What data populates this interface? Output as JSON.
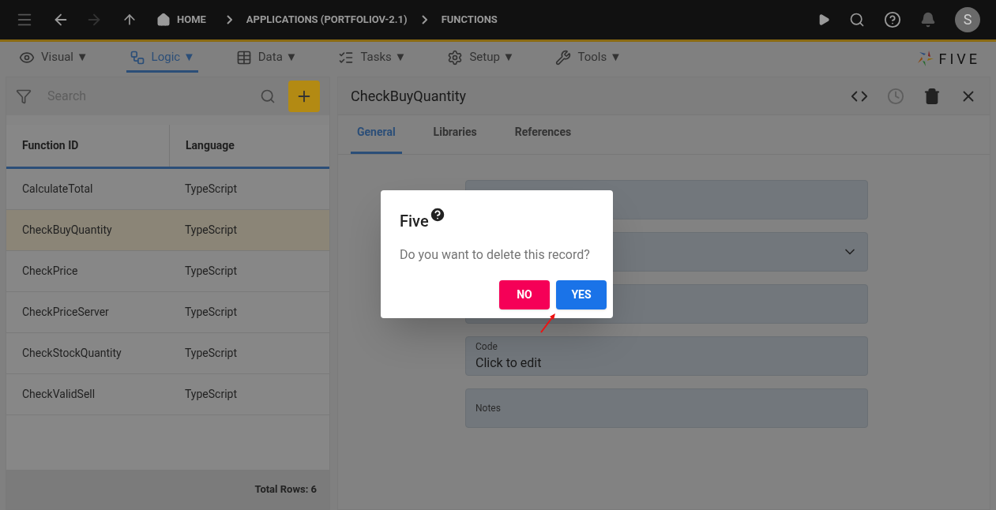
{
  "top_bar": {
    "breadcrumbs": [
      "HOME",
      "APPLICATIONS (PORTFOLIOV-2.1)",
      "FUNCTIONS"
    ],
    "avatar": "S"
  },
  "menu": [
    {
      "label": "Visual",
      "caret": "▼",
      "selected": false
    },
    {
      "label": "Logic",
      "caret": "▼",
      "selected": true
    },
    {
      "label": "Data",
      "caret": "▼",
      "selected": false
    },
    {
      "label": "Tasks",
      "caret": "▼",
      "selected": false
    },
    {
      "label": "Setup",
      "caret": "▼",
      "selected": false
    },
    {
      "label": "Tools",
      "caret": "▼",
      "selected": false
    }
  ],
  "logo": "FIVE",
  "list_panel": {
    "search": {
      "placeholder": "Search"
    },
    "columns": [
      "Function ID",
      "Language"
    ],
    "rows": [
      {
        "cells": [
          "CalculateTotal",
          "TypeScript"
        ],
        "selected": false
      },
      {
        "cells": [
          "CheckBuyQuantity",
          "TypeScript"
        ],
        "selected": true
      },
      {
        "cells": [
          "CheckPrice",
          "TypeScript"
        ],
        "selected": false
      },
      {
        "cells": [
          "CheckPriceServer",
          "TypeScript"
        ],
        "selected": false
      },
      {
        "cells": [
          "CheckStockQuantity",
          "TypeScript"
        ],
        "selected": false
      },
      {
        "cells": [
          "CheckValidSell",
          "TypeScript"
        ],
        "selected": false
      }
    ],
    "footer": "Total Rows: 6"
  },
  "form": {
    "title": "CheckBuyQuantity",
    "tabs": [
      {
        "label": "General",
        "selected": true
      },
      {
        "label": "Libraries",
        "selected": false
      },
      {
        "label": "References",
        "selected": false
      }
    ],
    "fields": [
      {
        "kind": "text"
      },
      {
        "kind": "select"
      },
      {
        "kind": "text"
      },
      {
        "kind": "text",
        "label": "Code",
        "value": "Click to edit"
      },
      {
        "kind": "text",
        "label": "Notes"
      }
    ]
  },
  "dialog": {
    "title": "Five",
    "message": "Do you want to delete this record?",
    "buttons": [
      {
        "label": "NO",
        "kind": "secondary"
      },
      {
        "label": "YES",
        "kind": "primary"
      }
    ]
  }
}
